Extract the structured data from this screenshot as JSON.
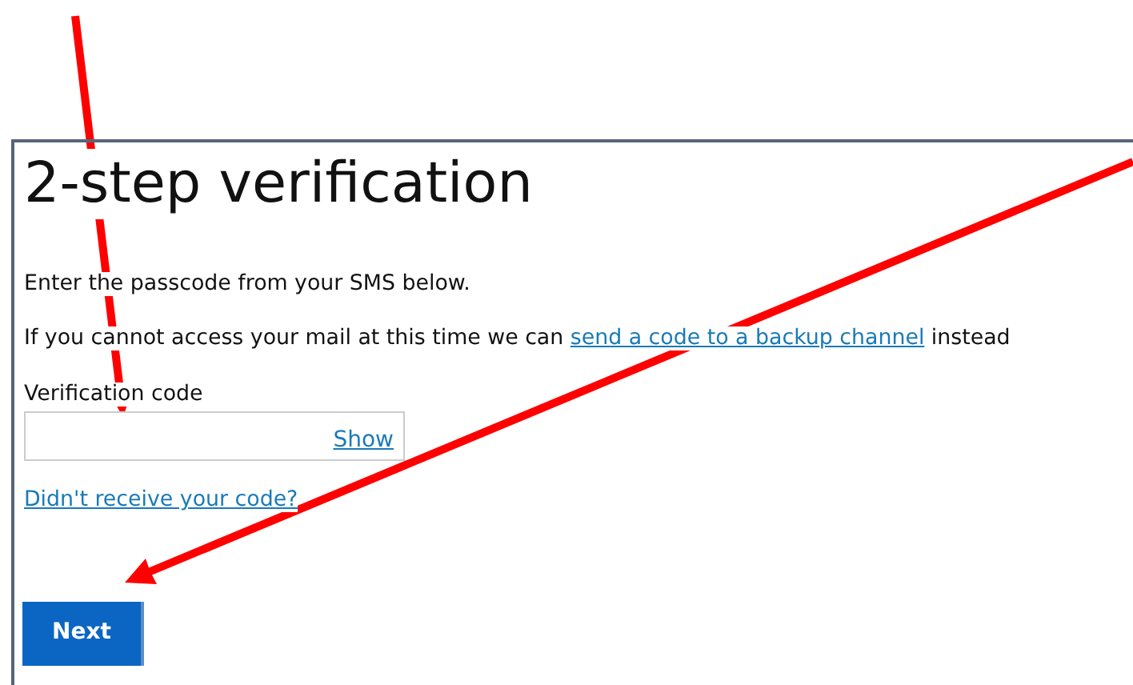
{
  "panel": {
    "title": "2-step verification",
    "instruction": "Enter the passcode from your SMS below.",
    "backup_text": {
      "before": "If you cannot access your mail at this time we can ",
      "link": "send a code to a backup channel",
      "after": " instead"
    },
    "field": {
      "label": "Verification code",
      "toggle": "Show"
    },
    "resend_link": "Didn't receive your code?",
    "next_button": "Next"
  }
}
